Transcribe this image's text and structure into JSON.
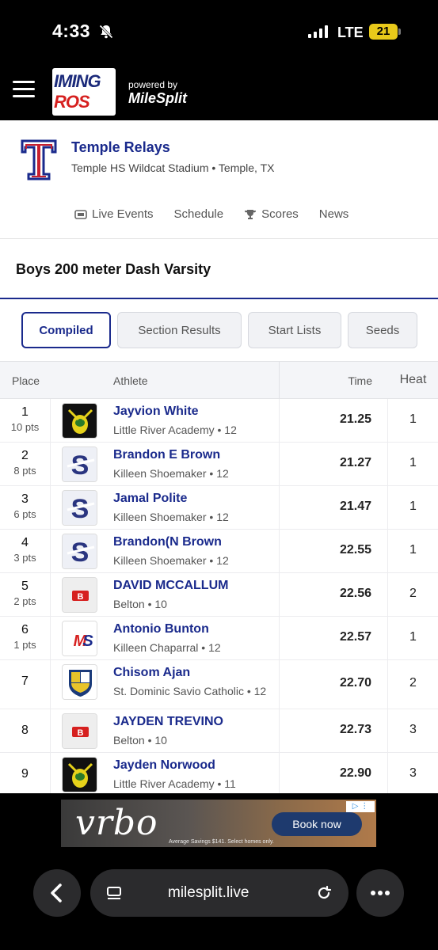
{
  "status": {
    "time": "4:33",
    "network": "LTE",
    "battery": "21"
  },
  "app": {
    "logo_line1": "IMING",
    "logo_line2": "ROS",
    "powered_by": "powered by",
    "brand": "MileSplit"
  },
  "meet": {
    "logo_letter": "T",
    "title": "Temple Relays",
    "venue": "Temple HS Wildcat Stadium • Temple, TX",
    "nav": [
      "Live Events",
      "Schedule",
      "Scores",
      "News"
    ]
  },
  "event": {
    "title": "Boys 200 meter Dash Varsity"
  },
  "tabs": [
    "Compiled",
    "Section Results",
    "Start Lists",
    "Seeds"
  ],
  "table": {
    "headers": {
      "place": "Place",
      "athlete": "Athlete",
      "time": "Time",
      "heat": "Heat"
    },
    "rows": [
      {
        "place": "1",
        "pts": "10 pts",
        "name": "Jayvion White",
        "team": "Little River Academy • 12",
        "time": "21.25",
        "heat": "1",
        "logo": "hornet-logo"
      },
      {
        "place": "2",
        "pts": "8 pts",
        "name": "Brandon E Brown",
        "team": "Killeen Shoemaker • 12",
        "time": "21.27",
        "heat": "1",
        "logo": "s-logo"
      },
      {
        "place": "3",
        "pts": "6 pts",
        "name": "Jamal Polite",
        "team": "Killeen Shoemaker • 12",
        "time": "21.47",
        "heat": "1",
        "logo": "s-logo"
      },
      {
        "place": "4",
        "pts": "3 pts",
        "name": "Brandon(N Brown",
        "team": "Killeen Shoemaker • 12",
        "time": "22.55",
        "heat": "1",
        "logo": "s-logo"
      },
      {
        "place": "5",
        "pts": "2 pts",
        "name": "DAVID MCCALLUM",
        "team": "Belton • 10",
        "time": "22.56",
        "heat": "2",
        "logo": "b-logo"
      },
      {
        "place": "6",
        "pts": "1 pts",
        "name": "Antonio Bunton",
        "team": "Killeen Chaparral • 12",
        "time": "22.57",
        "heat": "1",
        "logo": "ms-logo"
      },
      {
        "place": "7",
        "pts": "",
        "name": "Chisom Ajan",
        "team": "St. Dominic Savio Catholic • 12",
        "time": "22.70",
        "heat": "2",
        "logo": "crest-logo"
      },
      {
        "place": "8",
        "pts": "",
        "name": "JAYDEN TREVINO",
        "team": "Belton • 10",
        "time": "22.73",
        "heat": "3",
        "logo": "b-logo"
      },
      {
        "place": "9",
        "pts": "",
        "name": "Jayden Norwood",
        "team": "Little River Academy • 11",
        "time": "22.90",
        "heat": "3",
        "logo": "hornet-logo"
      }
    ]
  },
  "ad": {
    "brand": "vrbo",
    "cta": "Book now",
    "fine_print": "Average Savings $141. Select homes only."
  },
  "browser": {
    "url": "milesplit.live"
  },
  "colors": {
    "brand_blue": "#1a2a8c",
    "accent_red": "#d6201f"
  }
}
